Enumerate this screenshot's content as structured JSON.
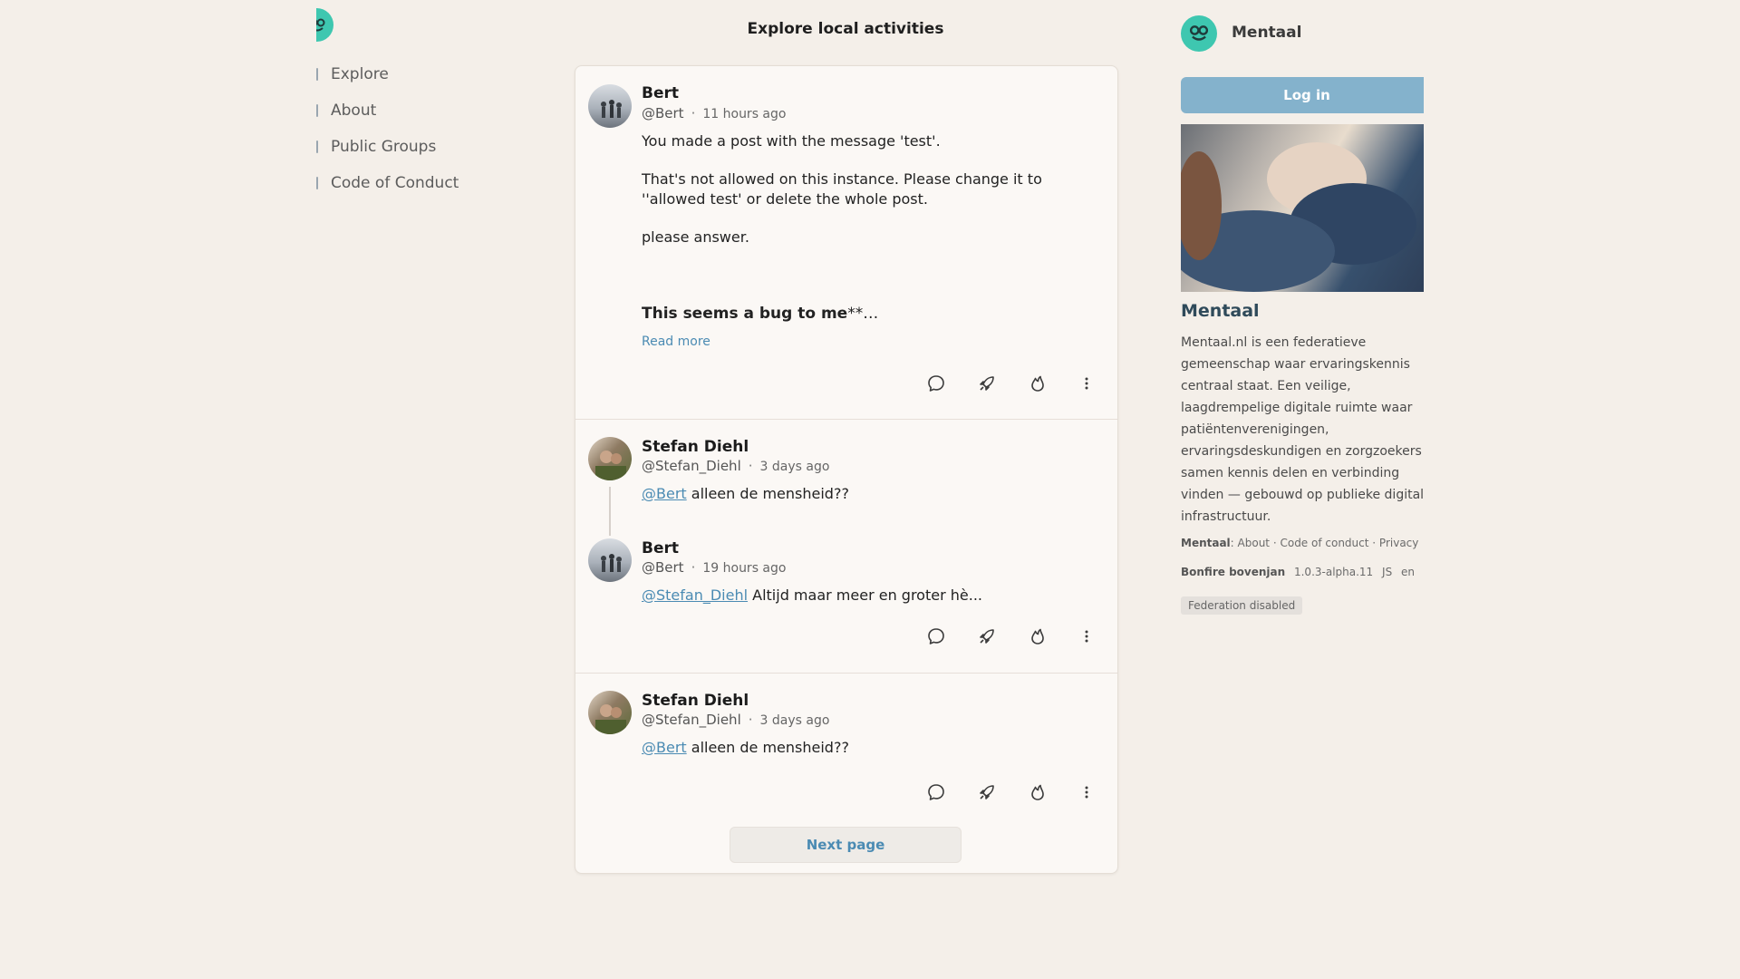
{
  "page": {
    "title": "Explore local activities"
  },
  "nav": {
    "items": [
      {
        "label": "Explore"
      },
      {
        "label": "About"
      },
      {
        "label": "Public Groups"
      },
      {
        "label": "Code of Conduct"
      }
    ]
  },
  "feed": {
    "posts": [
      {
        "name": "Bert",
        "handle": "@Bert",
        "time": "11 hours ago",
        "paragraphs": [
          "You made a post with the message 'test'.",
          "That's not allowed on this instance. Please change it to ''allowed test' or delete the whole post.",
          "please answer."
        ],
        "bold_line": "This seems a bug to me",
        "bold_suffix": "**…",
        "read_more": "Read more"
      },
      {
        "name": "Stefan Diehl",
        "handle": "@Stefan_Diehl",
        "time": "3 days ago",
        "mention": "@Bert",
        "text": " alleen de mensheid??"
      },
      {
        "name": "Bert",
        "handle": "@Bert",
        "time": "19 hours ago",
        "mention": "@Stefan_Diehl",
        "text": " Altijd maar meer en groter hè..."
      },
      {
        "name": "Stefan Diehl",
        "handle": "@Stefan_Diehl",
        "time": "3 days ago",
        "mention": "@Bert",
        "text": " alleen de mensheid??"
      }
    ],
    "dot": "·",
    "next_page": "Next page"
  },
  "sidebar": {
    "brand": "Mentaal",
    "login": "Log in",
    "site_title": "Mentaal",
    "description": "Mentaal.nl is een federatieve gemeenschap waar ervaringskennis centraal staat. Een veilige, laagdrempelige digitale ruimte waar patiëntenverenigingen, ervaringsdeskundigen en zorgzoekers samen kennis delen en verbinding vinden — gebouwd op publieke digitale infrastructuur.",
    "footer": {
      "site": "Mentaal",
      "colon": ": ",
      "about": "About",
      "sep": " · ",
      "coc": "Code of conduct",
      "privacy": "Privacy",
      "app": "Bonfire bovenjan",
      "version": "1.0.3-alpha.11",
      "js": "JS",
      "lang": "en"
    },
    "federation": "Federation disabled"
  },
  "colors": {
    "accent": "#4b8bb3",
    "login_bg": "#84b2cc",
    "logo": "#3ec7b0",
    "background": "#f4efe9"
  }
}
